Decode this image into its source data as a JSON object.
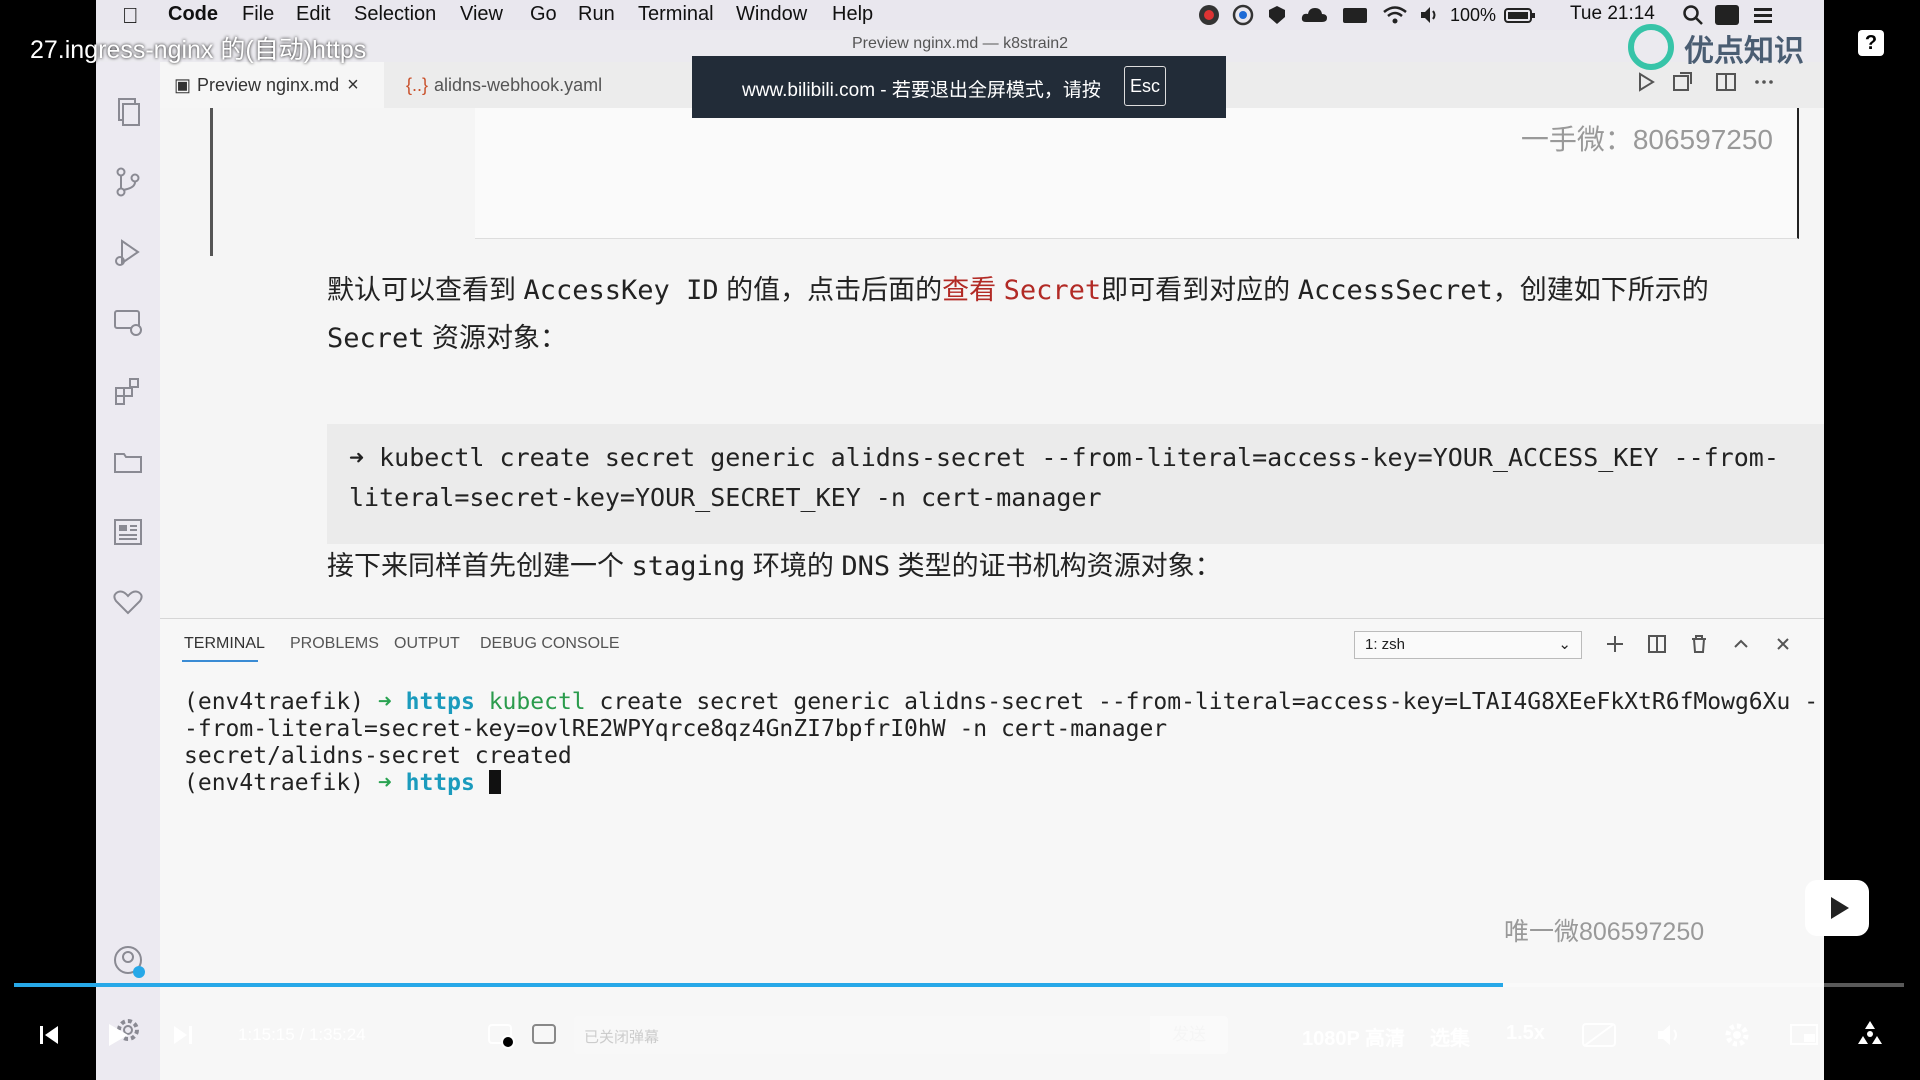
{
  "video": {
    "title": "27.ingress-nginx 的(自动)https",
    "current_time": "1:15:15",
    "separator": "/",
    "duration": "1:35:24",
    "progress": 0.788,
    "danmaku_placeholder": "已关闭弹幕",
    "send_label": "发送",
    "quality": "1080P 高清",
    "episodes": "选集",
    "speed": "1.5x",
    "fullscreen_toast": {
      "text": "www.bilibili.com - 若要退出全屏模式，请按",
      "key": "Esc"
    },
    "logo_text": "优点知识",
    "help_icon": "?"
  },
  "menubar": {
    "items": [
      "Code",
      "File",
      "Edit",
      "Selection",
      "View",
      "Go",
      "Run",
      "Terminal",
      "Window",
      "Help"
    ],
    "battery": "100%",
    "clock": "Tue 21:14"
  },
  "window": {
    "title": "Preview nginx.md — k8strain2"
  },
  "editor": {
    "tabs": [
      {
        "label": "Preview nginx.md",
        "icon": "preview-icon",
        "close": "×"
      },
      {
        "label": "alidns-webhook.yaml",
        "icon": "{..}"
      }
    ]
  },
  "preview": {
    "image_text": "一手微：806597250",
    "para1_a": "默认可以查看到 ",
    "para1_b": "AccessKey ID",
    "para1_c": " 的值，点击后面的",
    "para1_link_a": "查看 ",
    "para1_link_b": "Secret",
    "para1_d": "即可看到对应的 ",
    "para1_e": "AccessSecret",
    "para1_f": "，创建如下所示的",
    "para1_line2_a": "Secret",
    "para1_line2_b": " 资源对象：",
    "code_line1": "➜ kubectl create secret generic alidns-secret --from-literal=access-key=YOUR_ACCESS_KEY --from-",
    "code_line2": "literal=secret-key=YOUR_SECRET_KEY -n cert-manager",
    "para2_a": "接下来同样首先创建一个 ",
    "para2_b": "staging",
    "para2_c": " 环境的 ",
    "para2_d": "DNS",
    "para2_e": " 类型的证书机构资源对象："
  },
  "panel": {
    "tabs": [
      "TERMINAL",
      "PROBLEMS",
      "OUTPUT",
      "DEBUG CONSOLE"
    ],
    "shell_select": "1: zsh",
    "lines": {
      "l1_env": "(env4traefik) ",
      "l1_arrow": "➜",
      "l1_dir": "https",
      "l1_cmd": "kubectl",
      "l1_rest": " create secret generic alidns-secret --from-literal=access-key=LTAI4G8XEeFkXtR6fMowg6Xu -",
      "l2": "-from-literal=secret-key=ovlRE2WPYqrce8qz4GnZI7bpfrI0hW -n cert-manager",
      "l3": "secret/alidns-secret created",
      "l4_env": "(env4traefik) ",
      "l4_arrow": "➜",
      "l4_dir": "https"
    }
  },
  "watermark": "唯一微806597250",
  "colors": {
    "accent": "#3a8bd4",
    "progress": "#27a8e8",
    "link_red": "#b22a25",
    "prompt_green": "#2aa352",
    "dir_cyan": "#1b9bbd"
  }
}
